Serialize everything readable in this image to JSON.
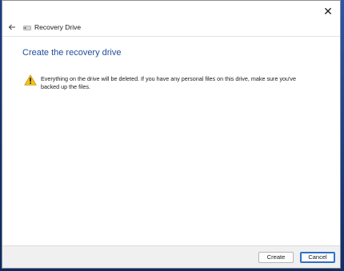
{
  "window": {
    "close_glyph": "✕"
  },
  "nav": {
    "title": "Recovery Drive",
    "back_icon": "back-arrow-icon",
    "drive_icon": "usb-drive-icon"
  },
  "content": {
    "heading": "Create the recovery drive",
    "warning_icon": "warning-icon",
    "warning_text": "Everything on the drive will be deleted. If you have any personal files on this drive, make sure you've backed up the files."
  },
  "footer": {
    "create_label": "Create",
    "cancel_label": "Cancel"
  },
  "colors": {
    "heading": "#1f4e99",
    "warning_yellow": "#f5c211",
    "default_button_border": "#2f6fca"
  }
}
